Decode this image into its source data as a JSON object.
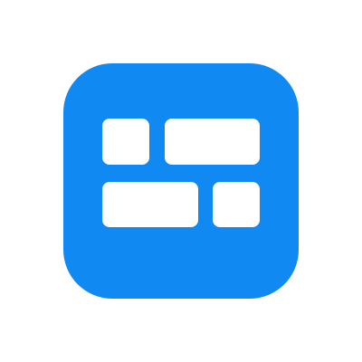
{
  "icon": {
    "name": "layout-grid-app-icon",
    "colors": {
      "tile": "#1189f2",
      "blocks": "#ffffff",
      "page_background": "#ffffff"
    }
  }
}
